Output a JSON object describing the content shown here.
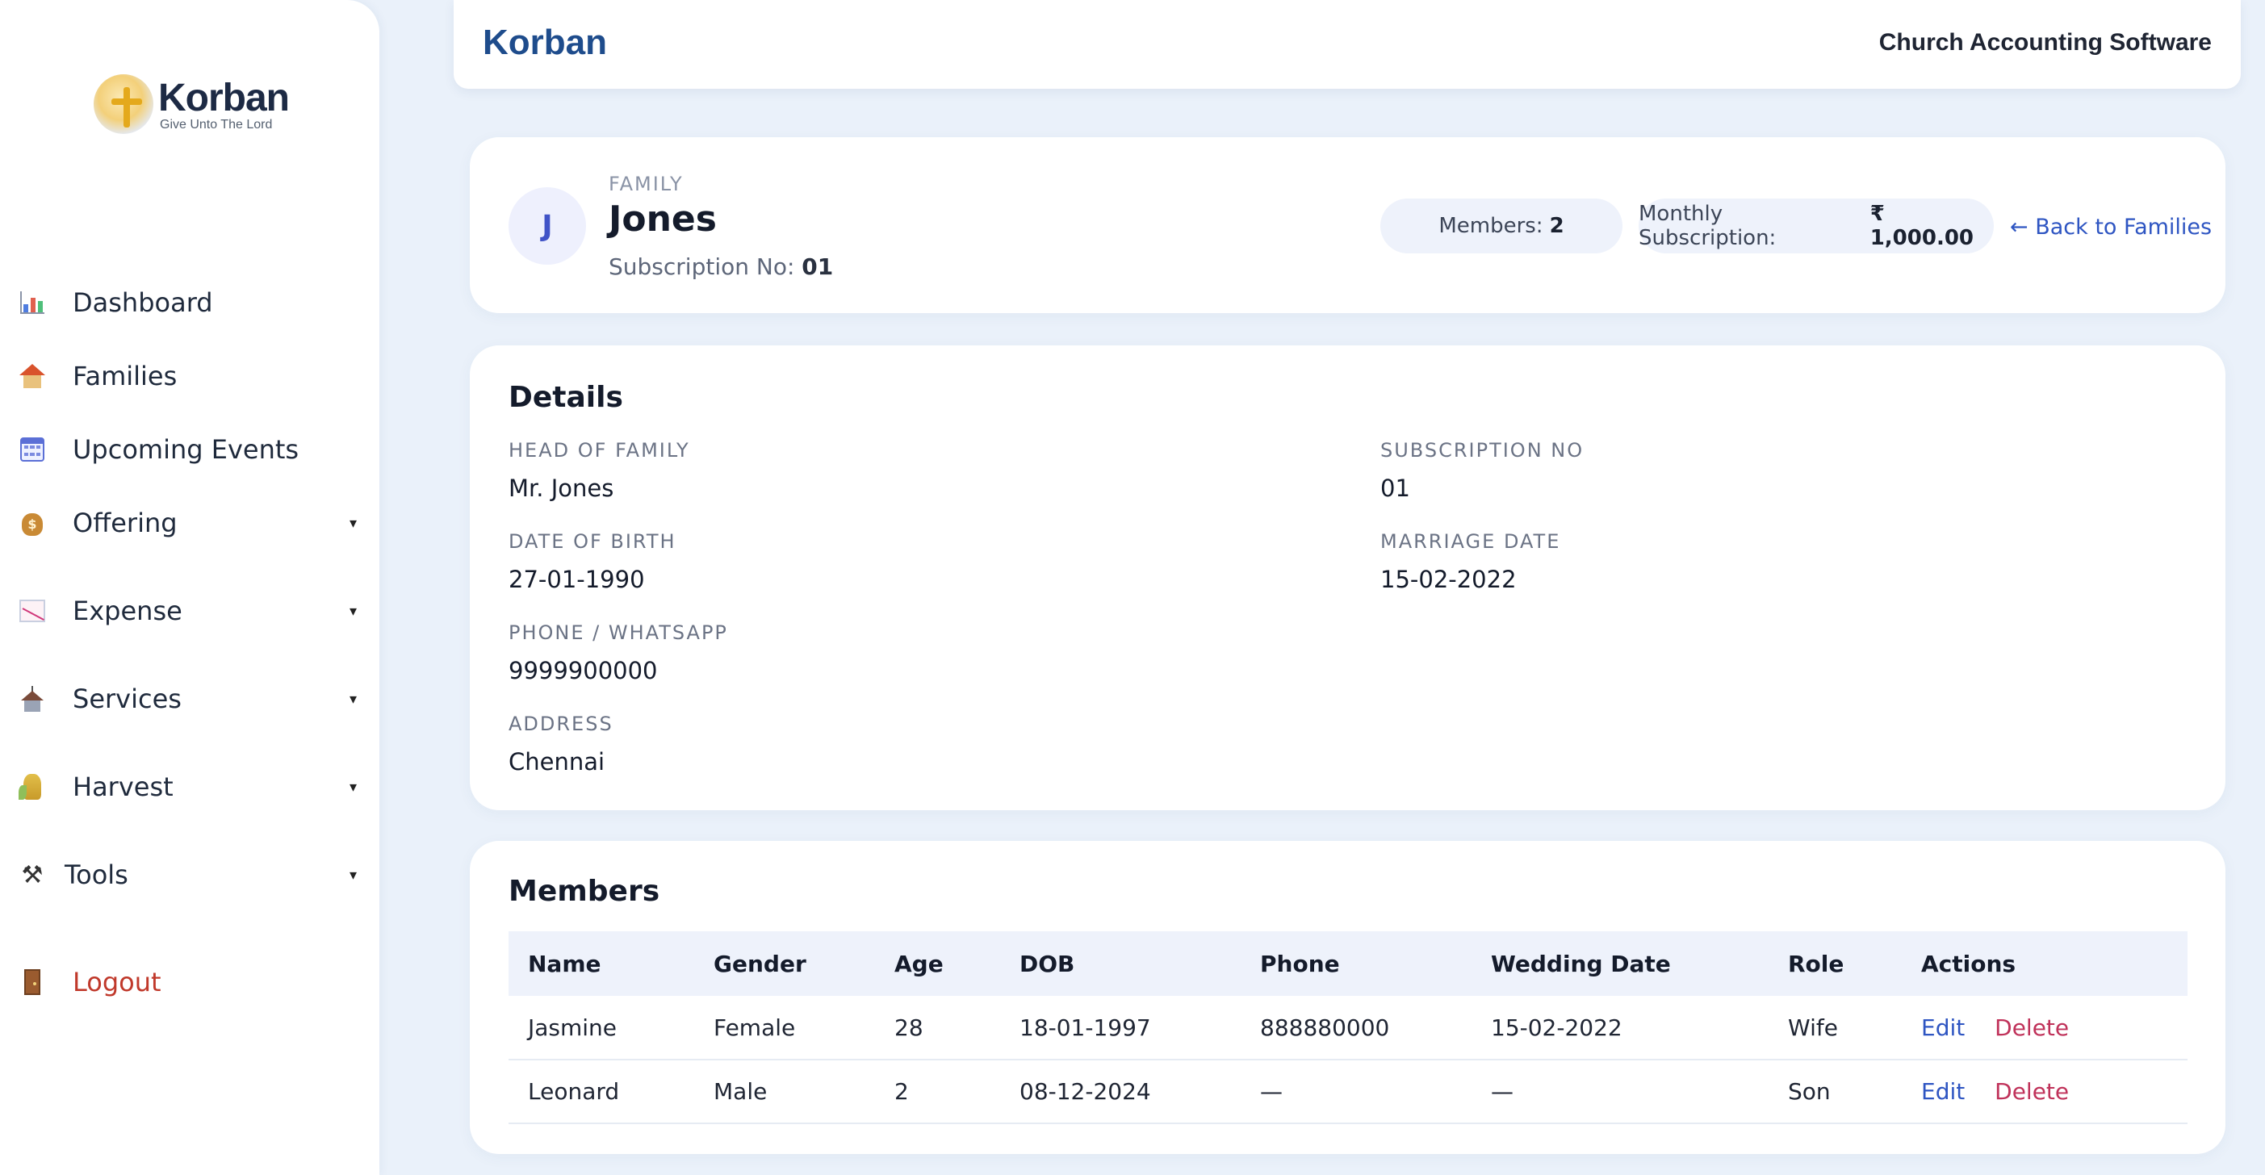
{
  "sidebar": {
    "logo": {
      "word": "Korban",
      "tagline": "Give Unto The Lord"
    },
    "items": [
      {
        "label": "Dashboard",
        "icon": "bar-chart-icon"
      },
      {
        "label": "Families",
        "icon": "house-icon"
      },
      {
        "label": "Upcoming Events",
        "icon": "calendar-icon"
      },
      {
        "label": "Offering",
        "icon": "money-bag-icon",
        "expandable": true
      },
      {
        "label": "Expense",
        "icon": "chart-decreasing-icon",
        "expandable": true
      },
      {
        "label": "Services",
        "icon": "church-icon",
        "expandable": true
      },
      {
        "label": "Harvest",
        "icon": "harvest-icon",
        "expandable": true
      },
      {
        "label": "Tools",
        "icon": "tools-icon",
        "expandable": true
      }
    ],
    "logout": "Logout",
    "caret": "▾"
  },
  "header": {
    "brand": "Korban",
    "subtitle": "Church Accounting Software"
  },
  "family": {
    "kicker": "FAMILY",
    "avatar_letter": "J",
    "name": "Jones",
    "subscription_label": "Subscription No:",
    "subscription_no": "01",
    "members_label": "Members:",
    "members_count": "2",
    "monthly_label": "Monthly Subscription:",
    "monthly_value": "₹ 1,000.00",
    "back_link": "← Back to Families"
  },
  "details": {
    "title": "Details",
    "fields": {
      "head_of_family": {
        "label": "HEAD OF FAMILY",
        "value": "Mr. Jones"
      },
      "subscription_no": {
        "label": "SUBSCRIPTION NO",
        "value": "01"
      },
      "date_of_birth": {
        "label": "DATE OF BIRTH",
        "value": "27-01-1990"
      },
      "marriage_date": {
        "label": "MARRIAGE DATE",
        "value": "15-02-2022"
      },
      "phone": {
        "label": "PHONE / WHATSAPP",
        "value": "9999900000"
      },
      "address": {
        "label": "ADDRESS",
        "value": "Chennai"
      }
    }
  },
  "members": {
    "title": "Members",
    "columns": [
      "Name",
      "Gender",
      "Age",
      "DOB",
      "Phone",
      "Wedding Date",
      "Role",
      "Actions"
    ],
    "rows": [
      {
        "name": "Jasmine",
        "gender": "Female",
        "age": "28",
        "dob": "18-01-1997",
        "phone": "888880000",
        "wedding_date": "15-02-2022",
        "role": "Wife",
        "edit": "Edit",
        "delete": "Delete"
      },
      {
        "name": "Leonard",
        "gender": "Male",
        "age": "2",
        "dob": "08-12-2024",
        "phone": "—",
        "wedding_date": "—",
        "role": "Son",
        "edit": "Edit",
        "delete": "Delete"
      }
    ]
  },
  "colors": {
    "page_bg": "#eaf1fa",
    "brand": "#1e4c8c",
    "link": "#2e55c2",
    "danger": "#c0325a",
    "logout": "#c0392b"
  }
}
